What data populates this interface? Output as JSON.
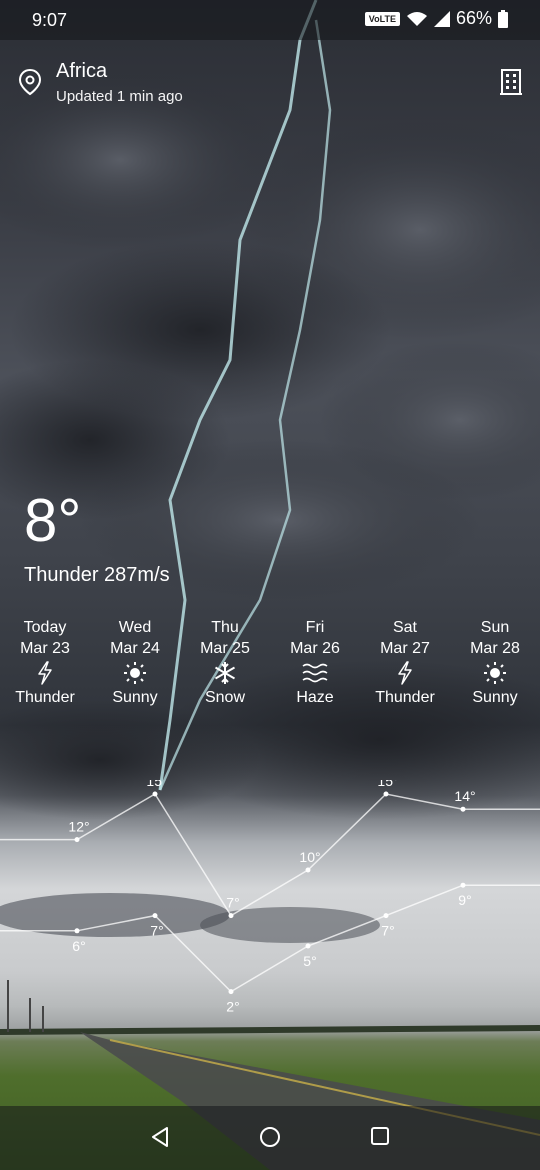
{
  "status_bar": {
    "time": "9:07",
    "volte": "VoLTE",
    "battery": "66%"
  },
  "location": {
    "name": "Africa",
    "updated": "Updated 1 min ago"
  },
  "current": {
    "temperature": "8°",
    "condition": "Thunder 287m/s"
  },
  "forecast": [
    {
      "day": "Today",
      "date": "Mar 23",
      "condition": "Thunder",
      "icon": "lightning-icon"
    },
    {
      "day": "Wed",
      "date": "Mar 24",
      "condition": "Sunny",
      "icon": "sun-icon"
    },
    {
      "day": "Thu",
      "date": "Mar 25",
      "condition": "Snow",
      "icon": "snowflake-icon"
    },
    {
      "day": "Fri",
      "date": "Mar 26",
      "condition": "Haze",
      "icon": "haze-icon"
    },
    {
      "day": "Sat",
      "date": "Mar 27",
      "condition": "Thunder",
      "icon": "lightning-icon"
    },
    {
      "day": "Sun",
      "date": "Mar 28",
      "condition": "Sunny",
      "icon": "sun-icon"
    }
  ],
  "chart_data": {
    "type": "line",
    "categories": [
      "Today",
      "Wed",
      "Thu",
      "Fri",
      "Sat",
      "Sun"
    ],
    "series": [
      {
        "values": [
          12,
          15,
          7,
          10,
          15,
          14
        ],
        "labels": [
          "12°",
          "15°",
          "7°",
          "10°",
          "15°",
          "14°"
        ]
      },
      {
        "values": [
          6,
          7,
          2,
          5,
          7,
          9
        ],
        "labels": [
          "6°",
          "7°",
          "2°",
          "5°",
          "7°",
          "9°"
        ]
      }
    ],
    "ylim": [
      0,
      16
    ]
  },
  "colors": {
    "line": "#ffffff"
  }
}
